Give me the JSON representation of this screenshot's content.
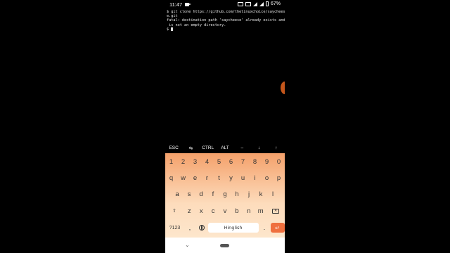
{
  "status_bar": {
    "time": "11:47",
    "battery": "67%",
    "icons": [
      "video-icon",
      "sim-icon",
      "volte-icon",
      "signal-icon",
      "signal-icon",
      "battery-icon"
    ]
  },
  "terminal": {
    "lines": [
      "$ git clone https://github.com/thelinuxchoice/saychees",
      "e.git",
      "fatal: destination path 'saycheese' already exists and",
      " is not an empty directory.",
      "$ "
    ]
  },
  "extra_keys": [
    "ESC",
    "⇆",
    "CTRL",
    "ALT",
    "–",
    "↓",
    "↑"
  ],
  "keyboard": {
    "row_numbers": [
      "1",
      "2",
      "3",
      "4",
      "5",
      "6",
      "7",
      "8",
      "9",
      "0"
    ],
    "row_1": [
      "q",
      "w",
      "e",
      "r",
      "t",
      "y",
      "u",
      "i",
      "o",
      "p"
    ],
    "row_2": [
      "a",
      "s",
      "d",
      "f",
      "g",
      "h",
      "j",
      "k",
      "l"
    ],
    "row_3": [
      "z",
      "x",
      "c",
      "v",
      "b",
      "n",
      "m"
    ],
    "shift": "⇧",
    "symbols": "?123",
    "comma": ",",
    "space": "Hinglish",
    "period": ".",
    "enter": "↵"
  },
  "nav": {
    "back": "⌄"
  },
  "colors": {
    "keyboard_top": "#f4a06a",
    "enter": "#ef6f3e",
    "bubble": "#c4561b"
  }
}
